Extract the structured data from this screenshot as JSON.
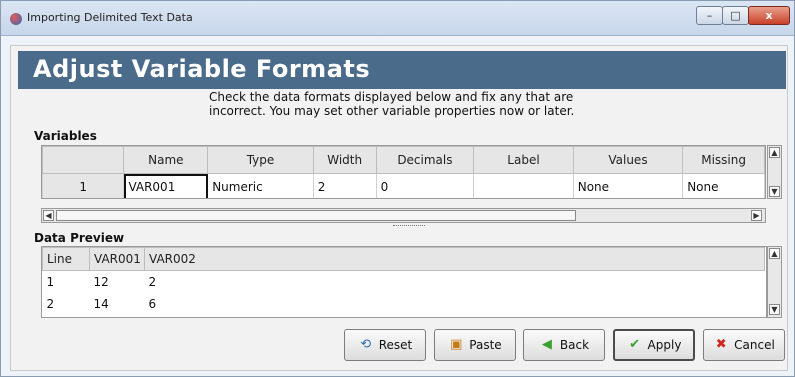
{
  "window": {
    "title": "Importing Delimited Text Data",
    "controls": {
      "minimize": "–",
      "maximize": "□",
      "close": "x"
    }
  },
  "header": {
    "title": "Adjust Variable Formats",
    "instructions": "Check the data formats displayed below and fix any that are incorrect.  You may set other variable properties now or later."
  },
  "variables": {
    "label": "Variables",
    "columns": [
      "Name",
      "Type",
      "Width",
      "Decimals",
      "Label",
      "Values",
      "Missing"
    ],
    "rows": [
      {
        "num": "1",
        "cells": [
          "VAR001",
          "Numeric",
          "2",
          "0",
          "",
          "None",
          "None"
        ]
      }
    ]
  },
  "preview": {
    "label": "Data Preview",
    "columns": [
      "Line",
      "VAR001",
      "VAR002"
    ],
    "rows": [
      [
        "1",
        "12",
        "2"
      ],
      [
        "2",
        "14",
        "6"
      ]
    ]
  },
  "buttons": {
    "reset": "Reset",
    "paste": "Paste",
    "back": "Back",
    "apply": "Apply",
    "cancel": "Cancel"
  },
  "colors": {
    "header_band": "#4b6b8a",
    "window_background": "#eef3f9"
  },
  "icons": {
    "app": "app-icon",
    "reset": "reset-icon",
    "paste": "paste-icon",
    "back": "back-arrow-icon",
    "apply": "checkmark-icon",
    "cancel": "cancel-x-icon"
  }
}
